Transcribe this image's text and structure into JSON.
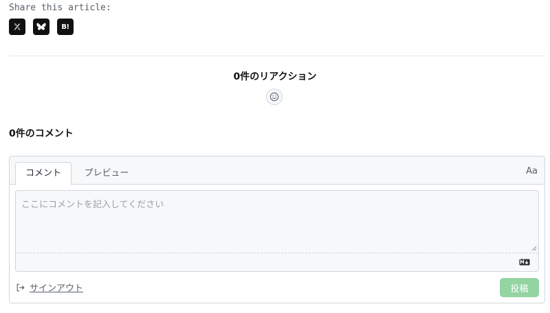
{
  "share": {
    "label": "Share this article:",
    "buttons": [
      {
        "name": "x",
        "icon": "x-logo-icon"
      },
      {
        "name": "bluesky",
        "icon": "bluesky-butterfly-icon"
      },
      {
        "name": "hatena",
        "icon": "hatena-bookmark-icon",
        "text": "B!"
      }
    ]
  },
  "reactions": {
    "title": "0件のリアクション",
    "icon": "smiley-icon"
  },
  "comments": {
    "count_title": "0件のコメント",
    "tabs": [
      {
        "label": "コメント",
        "active": true
      },
      {
        "label": "プレビュー",
        "active": false
      }
    ],
    "font_toggle": "Aa",
    "textarea": {
      "value": "",
      "placeholder": "ここにコメントを記入してください"
    },
    "markdown_icon": "markdown-icon",
    "signout_label": "サインアウト",
    "signout_icon": "sign-out-icon",
    "post_label": "投稿"
  },
  "colors": {
    "post_button_disabled": "#94d3a2",
    "border": "#d0d7de",
    "muted_text": "#57606a"
  }
}
